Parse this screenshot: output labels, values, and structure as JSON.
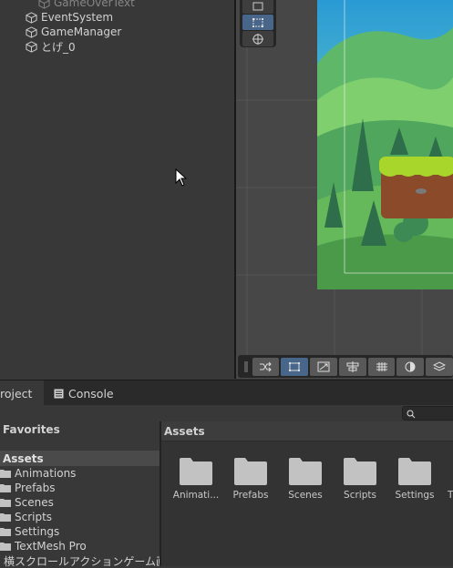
{
  "hierarchy": {
    "items": [
      {
        "label": "GameOverText",
        "icon": "cube-icon",
        "dim": true
      },
      {
        "label": "EventSystem",
        "icon": "cube-icon"
      },
      {
        "label": "GameManager",
        "icon": "cube-icon"
      },
      {
        "label": "とげ_0",
        "icon": "cube-icon"
      }
    ]
  },
  "scene": {
    "tools": [
      "rect-tool-icon",
      "rect-transform-icon",
      "transform-icon"
    ],
    "snap_buttons": [
      "grid-snap-icon",
      "rect-icon",
      "scale-icon",
      "align-icon",
      "grid-icon",
      "moon-icon",
      "layers-icon"
    ]
  },
  "tabs": {
    "project": "roject",
    "console": "Console"
  },
  "project": {
    "favorites": "Favorites",
    "assets_root": "Assets",
    "tree": [
      "Animations",
      "Prefabs",
      "Scenes",
      "Scripts",
      "Settings",
      "TextMesh Pro",
      "横スクロールアクションゲーム画像素"
    ],
    "breadcrumb": "Assets",
    "folders": [
      "Animati...",
      "Prefabs",
      "Scenes",
      "Scripts",
      "Settings",
      "T"
    ]
  },
  "colors": {
    "accent": "#47668a",
    "bg": "#383838"
  }
}
